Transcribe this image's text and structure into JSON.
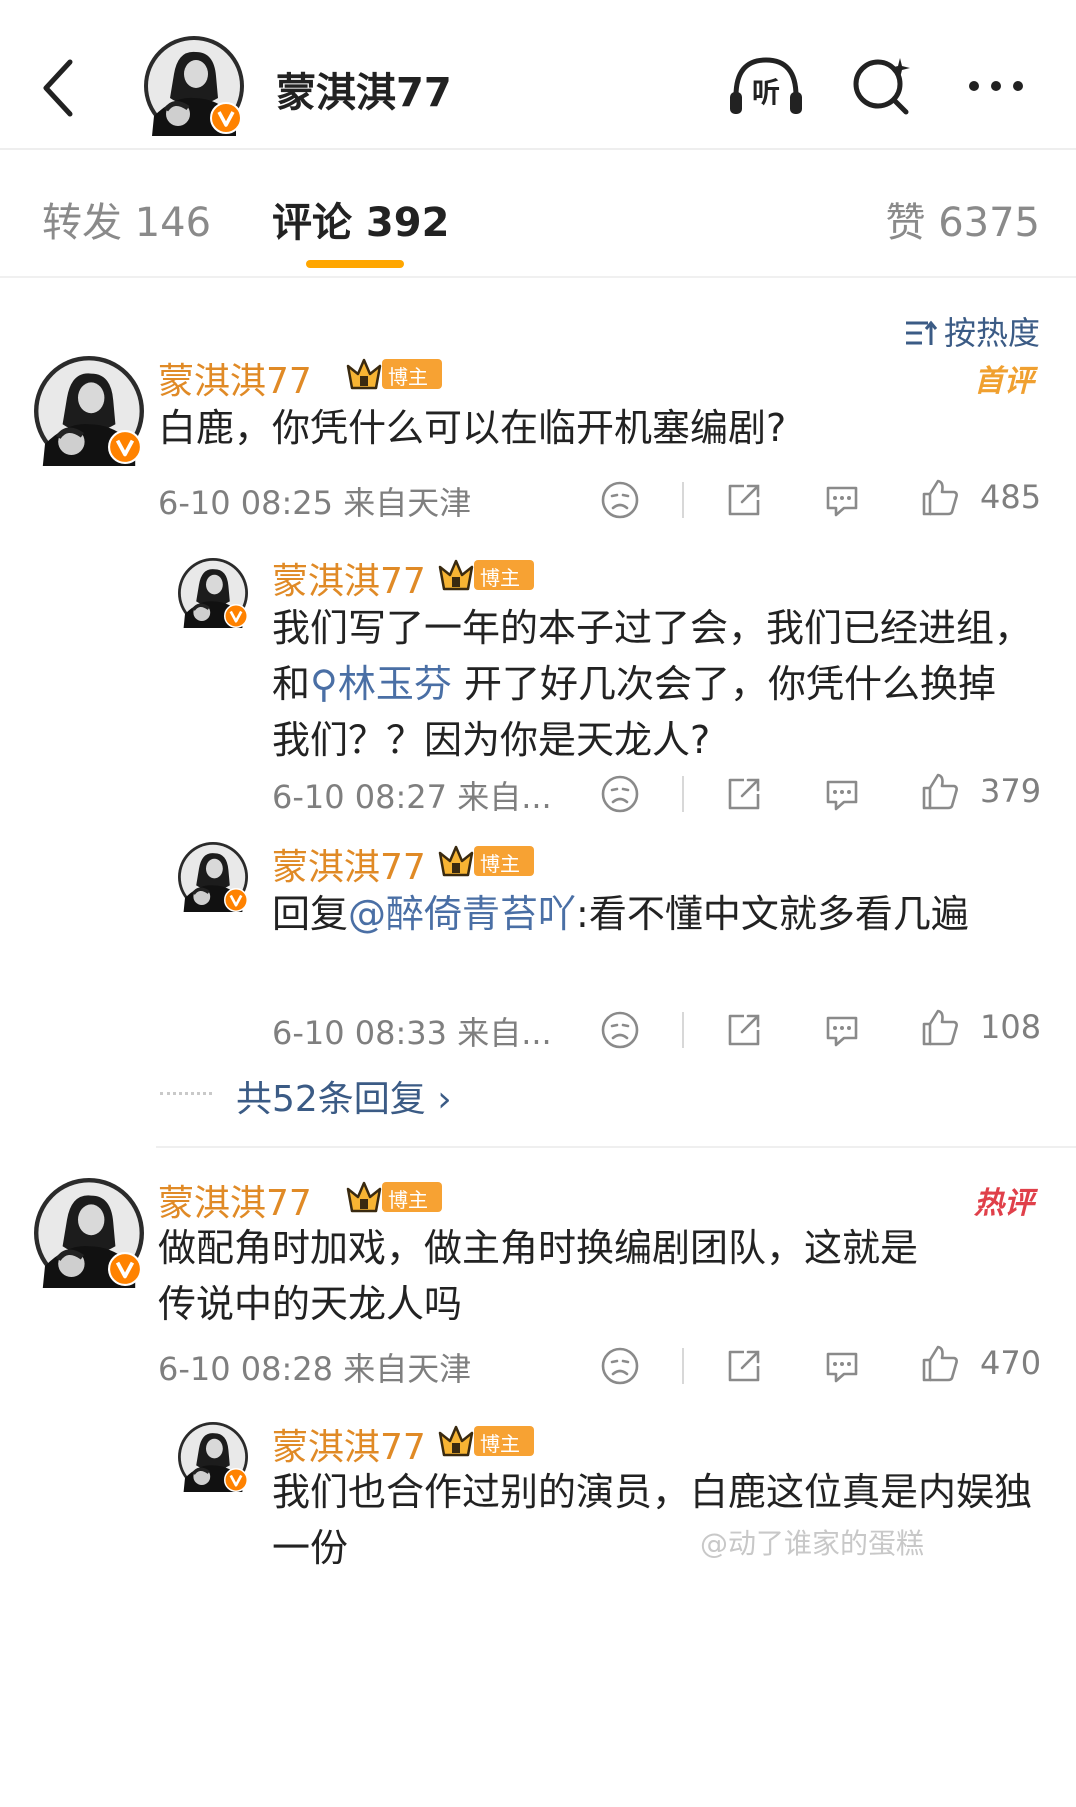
{
  "header": {
    "title": "蒙淇淇77",
    "listen_label": "听"
  },
  "tabs": [
    {
      "label": "转发 146"
    },
    {
      "label": "评论 392"
    },
    {
      "label": "赞 6375"
    }
  ],
  "sort_label": "按热度",
  "comments": [
    {
      "user": "蒙淇淇77",
      "badge": "博主",
      "tag": "首评",
      "text": "白鹿，你凭什么可以在临开机塞编剧?",
      "meta": "6-10 08:25 来自天津",
      "likes": "485",
      "replies": [
        {
          "user": "蒙淇淇77",
          "badge": "博主",
          "text_a": "我们写了一年的本子过了会，我们已经进组，和",
          "mention": "林玉芬",
          "text_b": " 开了好几次会了，你凭什么换掉我们？？因为你是天龙人?",
          "meta": "6-10 08:27 来自...",
          "likes": "379"
        },
        {
          "user": "蒙淇淇77",
          "badge": "博主",
          "text_a": "回复",
          "mention": "@醉倚青苔吖",
          "text_b": ":看不懂中文就多看几遍",
          "meta": "6-10 08:33 来自...",
          "likes": "108"
        }
      ],
      "more_replies": "共52条回复 ›"
    },
    {
      "user": "蒙淇淇77",
      "badge": "博主",
      "tag": "热评",
      "text": "做配角时加戏，做主角时换编剧团队，这就是传说中的天龙人吗",
      "meta": "6-10 08:28 来自天津",
      "likes": "470",
      "replies": [
        {
          "user": "蒙淇淇77",
          "badge": "博主",
          "text": "我们也合作过别的演员，白鹿这位真是内娱独一份"
        }
      ]
    }
  ],
  "watermark": "@动了谁家的蛋糕",
  "colors": {
    "accent": "#ffa600",
    "username": "#e08a26",
    "link": "#3b5b85",
    "first_tag": "#f0a030",
    "hot_tag": "#e0404a"
  },
  "icons": [
    "back-icon",
    "headphone-icon",
    "search-icon",
    "more-icon",
    "sort-icon",
    "verified-icon",
    "dislike-icon",
    "share-icon",
    "comment-icon",
    "like-icon",
    "crown-icon"
  ]
}
